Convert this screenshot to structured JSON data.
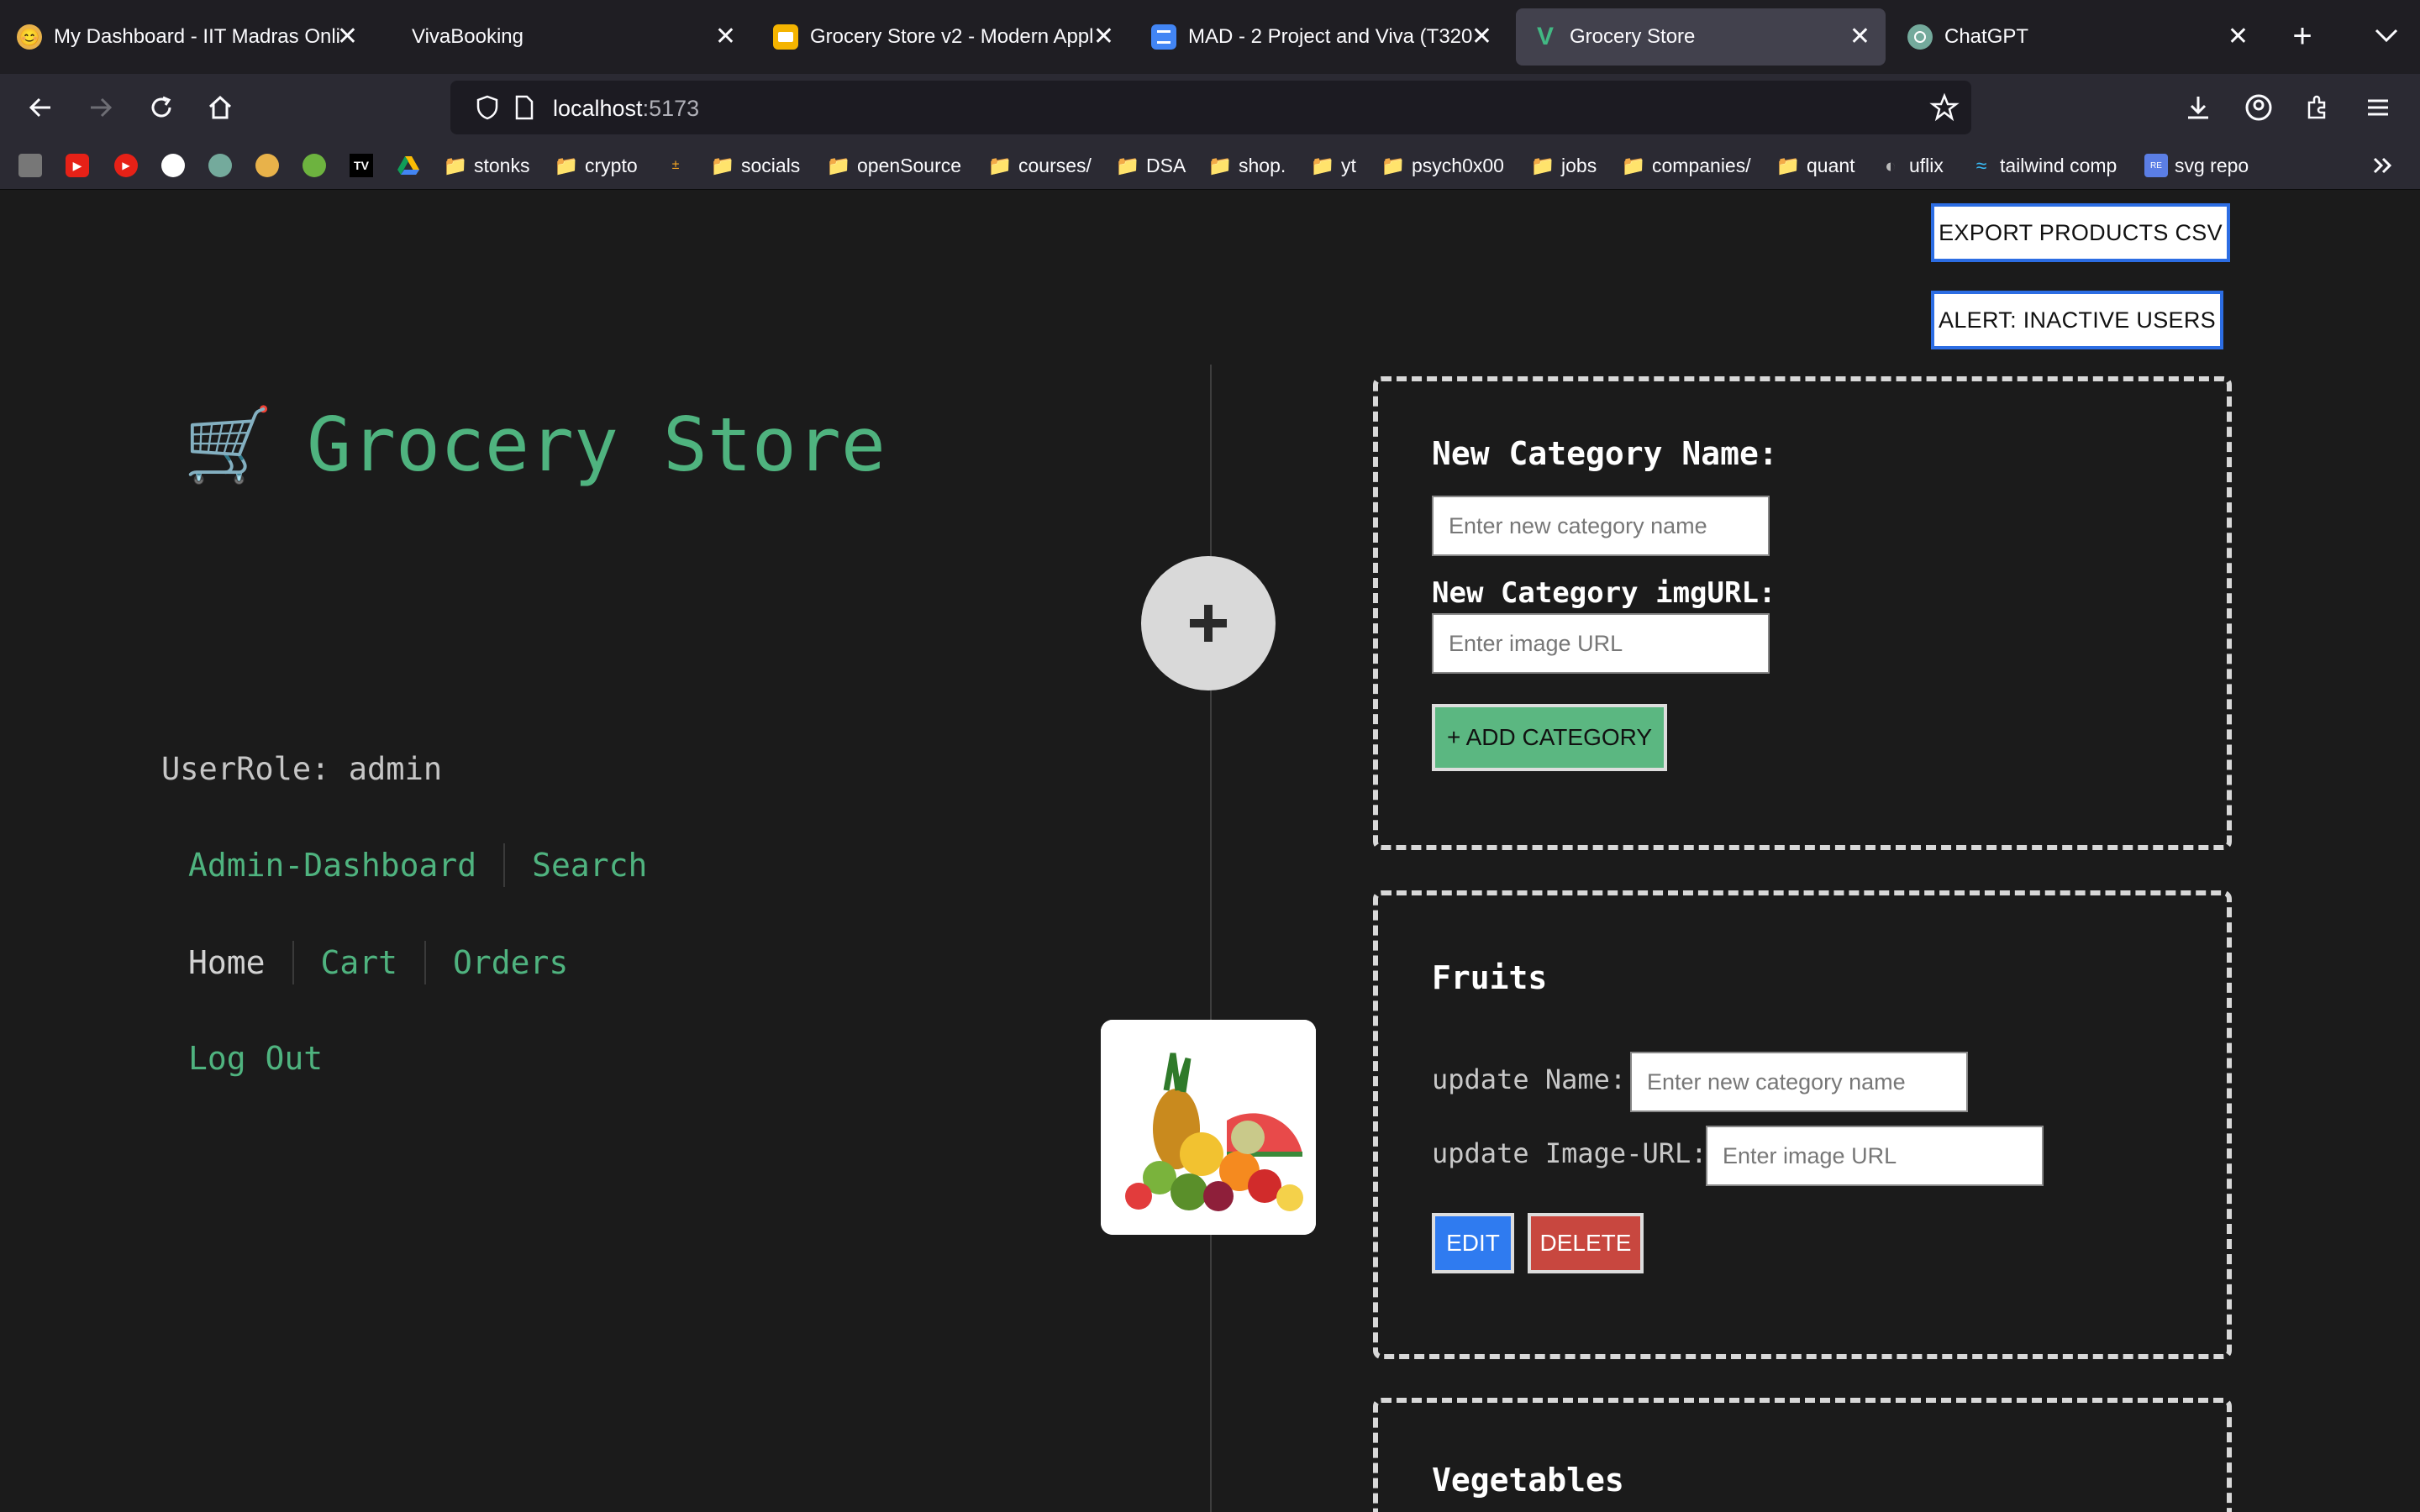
{
  "browser": {
    "tabs": [
      {
        "title": "My Dashboard - IIT Madras Onli",
        "active": false
      },
      {
        "title": "VivaBooking",
        "active": false
      },
      {
        "title": "Grocery Store v2 - Modern Appl",
        "active": false
      },
      {
        "title": "MAD - 2 Project and Viva (T320",
        "active": false
      },
      {
        "title": "Grocery Store",
        "active": true
      },
      {
        "title": "ChatGPT",
        "active": false
      }
    ],
    "url_host": "localhost",
    "url_port": ":5173",
    "bookmarks": [
      "stonks",
      "crypto",
      "socials",
      "openSource",
      "courses/",
      "DSA",
      "shop.",
      "yt",
      "psych0x00",
      "jobs",
      "companies/",
      "quant",
      "uflix",
      "tailwind comp",
      "svg repo"
    ]
  },
  "app": {
    "export_button": "EXPORT PRODUCTS CSV",
    "alert_button": "ALERT: INACTIVE USERS",
    "brand_icon": "🛒",
    "brand_title": "Grocery Store",
    "user_role": "UserRole: admin",
    "nav_row1": [
      "Admin-Dashboard",
      "Search"
    ],
    "nav_row2": [
      "Home",
      "Cart",
      "Orders"
    ],
    "logout": "Log Out",
    "new_category": {
      "name_label": "New Category Name:",
      "name_placeholder": "Enter new category name",
      "img_label": "New Category imgURL:",
      "img_placeholder": "Enter image URL",
      "add_button": "+ ADD CATEGORY"
    },
    "categories": [
      {
        "name": "Fruits",
        "update_name_label": "update Name:",
        "update_name_placeholder": "Enter new category name",
        "update_img_label": "update Image-URL:",
        "update_img_placeholder": "Enter image URL",
        "edit_button": "EDIT",
        "delete_button": "DELETE"
      },
      {
        "name": "Vegetables"
      }
    ]
  },
  "colors": {
    "accent": "#4fb37f",
    "edit": "#2f7bf0",
    "delete": "#c8473f",
    "add": "#5bb781"
  }
}
